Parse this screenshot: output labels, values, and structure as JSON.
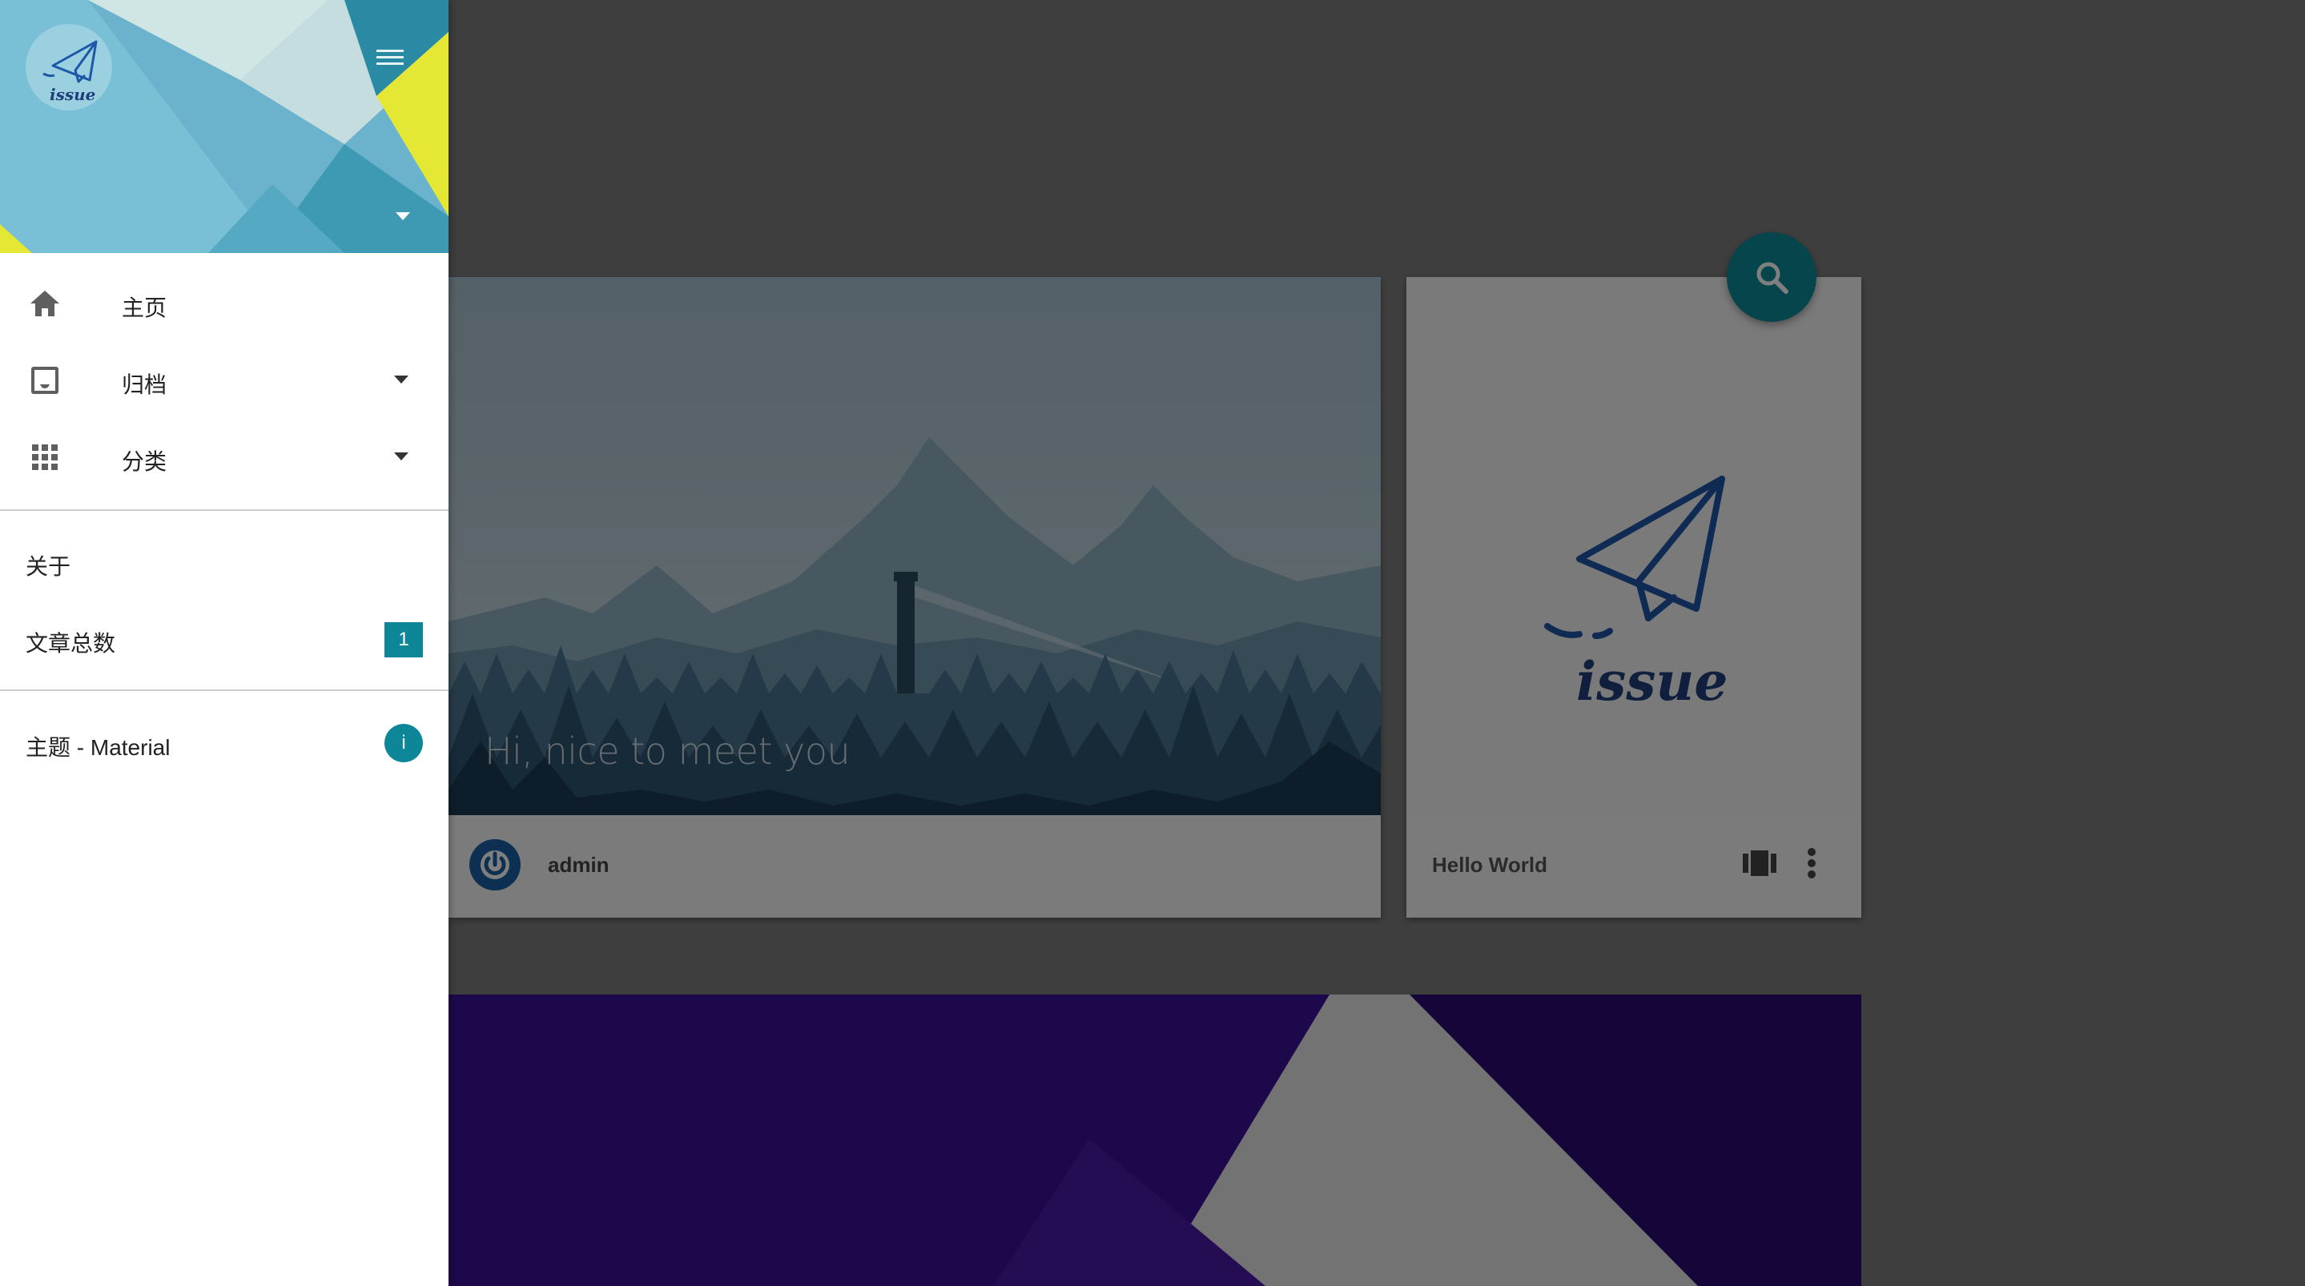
{
  "drawer": {
    "logo_text": "issue",
    "nav": [
      {
        "label": "主页",
        "icon": "home-icon"
      },
      {
        "label": "归档",
        "icon": "inbox-icon"
      },
      {
        "label": "分类",
        "icon": "apps-grid-icon"
      }
    ],
    "about_label": "关于",
    "article_count_label": "文章总数",
    "article_count": "1",
    "theme_label": "主题 - Material",
    "theme_badge": "i"
  },
  "hero": {
    "greeting": "Hi, nice to meet you",
    "author": "admin"
  },
  "post": {
    "logo_text": "issue",
    "title": "Hello World"
  },
  "colors": {
    "accent": "#0a8a97",
    "drawer_bg": "#ffffff",
    "backdrop": "#7d7d7d",
    "banner": "#3a1196"
  }
}
